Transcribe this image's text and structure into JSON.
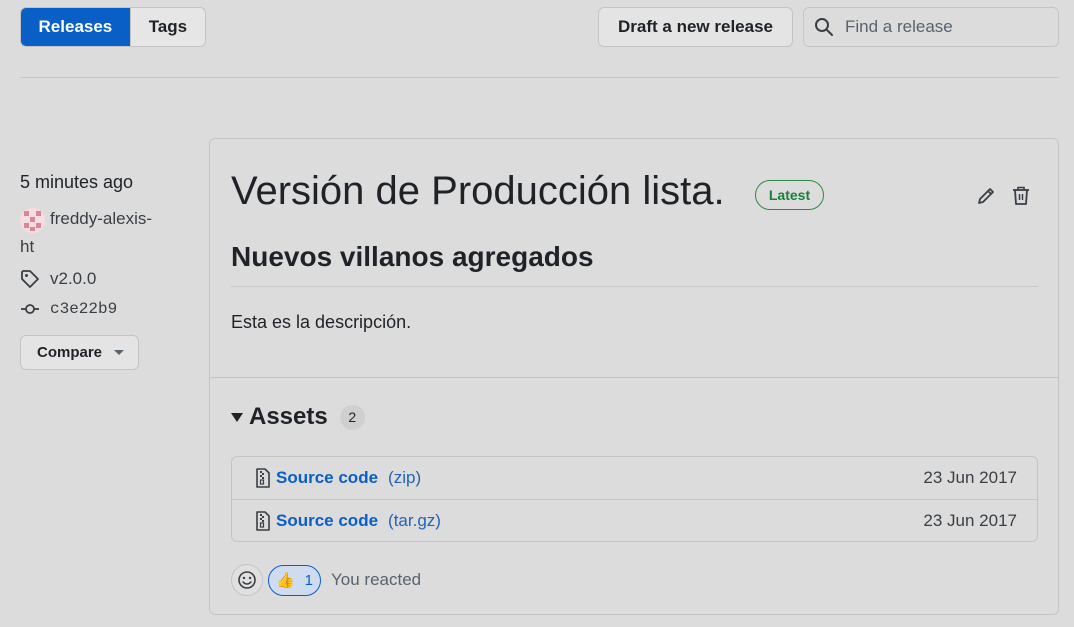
{
  "tabs": [
    {
      "label": "Releases",
      "active": true
    },
    {
      "label": "Tags",
      "active": false
    }
  ],
  "toolbar": {
    "draft_label": "Draft a new release",
    "search_placeholder": "Find a release"
  },
  "release_meta": {
    "time": "5 minutes ago",
    "author_line1": "freddy-alexis-",
    "author_line2": "ht",
    "tag": "v2.0.0",
    "commit": "c3e22b9",
    "compare_label": "Compare"
  },
  "release": {
    "title": "Versión de Producción lista.",
    "badge": "Latest",
    "subtitle": "Nuevos villanos agregados",
    "description": "Esta es la descripción."
  },
  "assets": {
    "title": "Assets",
    "count": "2",
    "items": [
      {
        "name": "Source code",
        "ext": "(zip)",
        "date": "23 Jun 2017"
      },
      {
        "name": "Source code",
        "ext": "(tar.gz)",
        "date": "23 Jun 2017"
      }
    ]
  },
  "reactions": {
    "thumbs_emoji": "👍",
    "thumbs_count": "1",
    "you_reacted": "You reacted"
  },
  "colors": {
    "accent": "#0a5fc7",
    "latest_green": "#1a7f37",
    "background": "#dcdcdc"
  },
  "icons": [
    "search-icon",
    "tag-icon",
    "commit-icon",
    "pencil-icon",
    "trash-icon",
    "file-zip-icon",
    "smiley-icon",
    "thumbs-up-icon",
    "chevron-down-icon"
  ]
}
